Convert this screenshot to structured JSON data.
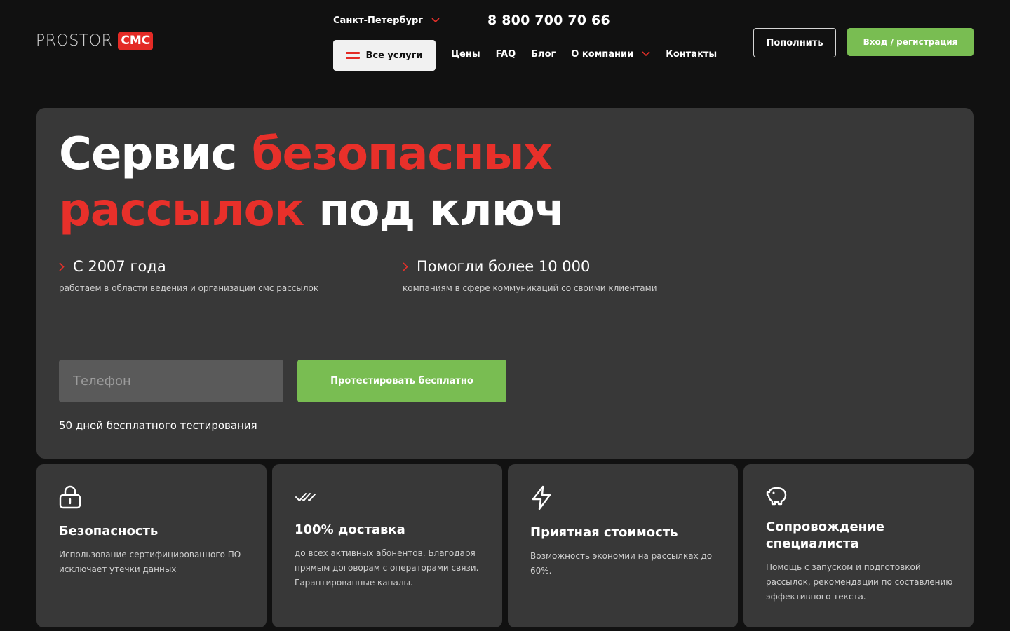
{
  "header": {
    "logo_text": "PROSTOR",
    "logo_badge": "СМС",
    "city": "Санкт-Петербург",
    "phone": "8 800 700 70 66",
    "all_services_label": "Все услуги",
    "nav": [
      "Цены",
      "FAQ",
      "Блог",
      "О компании",
      "Контакты"
    ],
    "topup_label": "Пополнить",
    "login_label": "Вход / регистрация"
  },
  "hero": {
    "title_part1": "Сервис ",
    "title_part2": "безопасных",
    "title_part3": "рассылок",
    "title_part4": " под ключ",
    "features": [
      {
        "title": "С 2007 года",
        "subtitle": "работаем в области ведения и организации смс рассылок"
      },
      {
        "title": "Помогли более 10 000",
        "subtitle": "компаниям в сфере коммуникаций со своими клиентами"
      }
    ],
    "phone_placeholder": "Телефон",
    "test_button": "Протестировать бесплатно",
    "trial_note": "50 дней бесплатного тестирования"
  },
  "cards": [
    {
      "icon": "lock-icon",
      "title": "Безопасность",
      "text": "Использование сертифицированного ПО исключает утечки данных"
    },
    {
      "icon": "double-check-icon",
      "title": "100% доставка",
      "text": "до всех активных абонентов. Благодаря прямым договорам с операторами связи. Гарантированные каналы."
    },
    {
      "icon": "lightning-icon",
      "title": "Приятная стоимость",
      "text": "Возможность экономии на рассылках до 60%."
    },
    {
      "icon": "piggy-bank-icon",
      "title": "Сопровождение специалиста",
      "text": "Помощь с запуском и подготовкой рассылок, рекомендации по составлению эффективного текста."
    }
  ],
  "colors": {
    "accent_red": "#e8302a",
    "accent_green": "#79bd52",
    "background": "#111111",
    "panel": "#383838"
  }
}
